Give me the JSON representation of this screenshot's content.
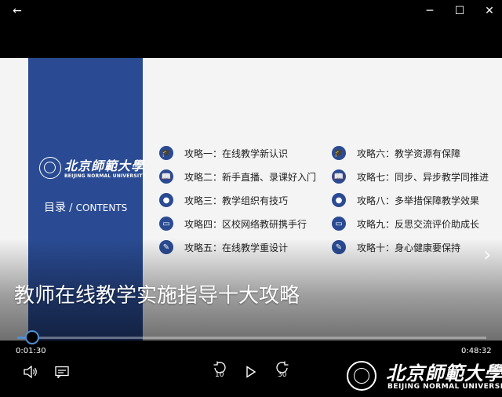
{
  "window": {
    "back_glyph": "←",
    "minimize_glyph": "─",
    "maximize_glyph": "☐",
    "close_glyph": "✕"
  },
  "slide": {
    "logo_cn": "北京師範大學",
    "logo_en": "BEIJING NORMAL UNIVERSITY",
    "contents_cn": "目录",
    "contents_sep": " / ",
    "contents_en": "CONTENTS",
    "items_left": [
      {
        "label": "攻略一：在线教学新认识",
        "icon": "mortarboard-icon",
        "glyph": "🎓"
      },
      {
        "label": "攻略二：新手直播、录课好入门",
        "icon": "book-icon",
        "glyph": "📖"
      },
      {
        "label": "攻略三：教学组织有技巧",
        "icon": "apple-icon",
        "glyph": "●"
      },
      {
        "label": "攻略四：区校网络教研携手行",
        "icon": "laptop-icon",
        "glyph": "▭"
      },
      {
        "label": "攻略五：在线教学重设计",
        "icon": "pencil-icon",
        "glyph": "✎"
      }
    ],
    "items_right": [
      {
        "label": "攻略六：教学资源有保障",
        "icon": "mortarboard-icon",
        "glyph": "🎓"
      },
      {
        "label": "攻略七：同步、异步教学同推进",
        "icon": "book-icon",
        "glyph": "📖"
      },
      {
        "label": "攻略八：多举措保障教学效果",
        "icon": "apple-icon",
        "glyph": "●"
      },
      {
        "label": "攻略九：反思交流评价助成长",
        "icon": "laptop-icon",
        "glyph": "▭"
      },
      {
        "label": "攻略十：身心健康要保持",
        "icon": "pencil-icon",
        "glyph": "✎"
      }
    ],
    "next_glyph": "›"
  },
  "video": {
    "title": "教师在线教学实施指导十大攻略",
    "current_time": "0:01:30",
    "total_time": "0:48:32",
    "progress_fraction": 0.031,
    "accent_color": "#4f8fd6"
  },
  "controls": {
    "rewind_label": "10",
    "forward_label": "30"
  },
  "watermark": {
    "cn": "北京師範大學",
    "en": "BEIJING NORMAL UNIVERSITY"
  }
}
